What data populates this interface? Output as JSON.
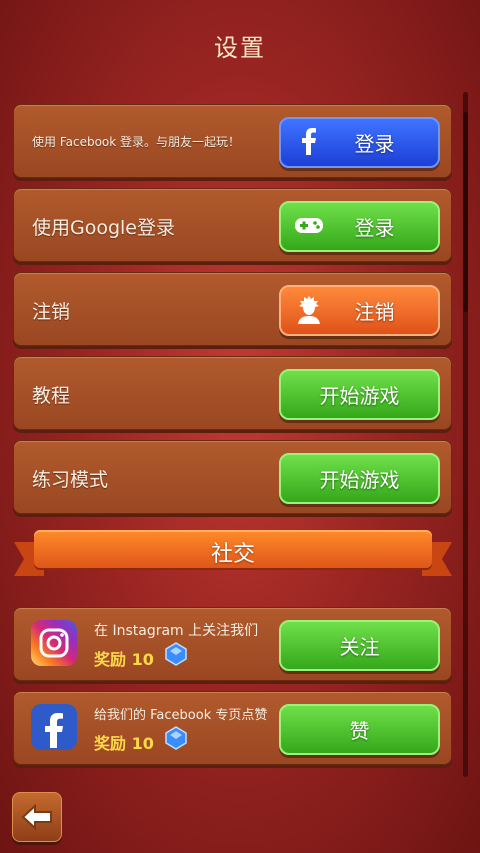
{
  "page": {
    "title": "设置"
  },
  "rows": [
    {
      "label": "使用 Facebook 登录。与朋友一起玩！",
      "button": "登录",
      "icon": "facebook-icon",
      "color": "#2948e0"
    },
    {
      "label": "使用Google登录",
      "button": "登录",
      "icon": "gamepad-icon",
      "color": "#44b823"
    },
    {
      "label": "注销",
      "button": "注销",
      "icon": "avatar-silhouette-icon",
      "color": "#ea5f1f"
    },
    {
      "label": "教程",
      "button": "开始游戏"
    },
    {
      "label": "练习模式",
      "button": "开始游戏"
    }
  ],
  "social": {
    "header": "社交",
    "items": [
      {
        "text": "在 Instagram 上关注我们",
        "reward": "奖励 10",
        "button": "关注",
        "icon": "instagram-icon"
      },
      {
        "text": "给我们的 Facebook 专页点赞",
        "reward": "奖励 10",
        "button": "赞",
        "icon": "facebook-icon"
      }
    ]
  },
  "footer": {
    "back_icon": "back-arrow-icon"
  }
}
